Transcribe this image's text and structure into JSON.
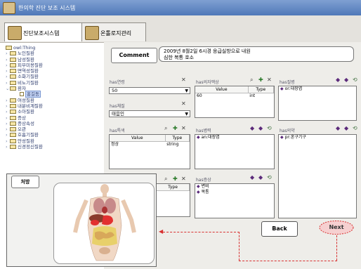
{
  "window": {
    "title": "한의학 진단 보조 시스템"
  },
  "tabs": [
    {
      "label": "진단보조시스템",
      "icon": "app-icon"
    },
    {
      "label": "온톨로지관리",
      "icon": "app-icon"
    }
  ],
  "tree": {
    "root": "owl:Thing",
    "items": [
      "노인질환",
      "남성질환",
      "피부미용질환",
      "면역성질환",
      "소화기질환",
      "비뇨기질환",
      "환자",
      "홍길동",
      "여성질환",
      "내분비계질환",
      "소아질환",
      "증상",
      "증상속성",
      "오관",
      "호흡기질환",
      "안성질환",
      "신경정신질환"
    ],
    "selected": "홍길동"
  },
  "comment": {
    "button": "Comment",
    "text_line1": "2009년 8월2일 6시경 응급실방으로 내원",
    "text_line2": "심한 복통 호소"
  },
  "properties": {
    "age": {
      "label": "has연령",
      "value": "50"
    },
    "constitution": {
      "label": "has체질",
      "value": "태음인"
    },
    "symptom_detail": {
      "label": "has의자맥상",
      "columns": [
        "Value",
        "Type"
      ],
      "rows": [
        [
          "60",
          "int"
        ]
      ]
    },
    "disease": {
      "label": "has질병",
      "items": [
        "or:대장염"
      ]
    },
    "traits": {
      "label": "has특색",
      "columns": [
        "Value",
        "Type"
      ],
      "rows": [
        [
          "정상",
          "string"
        ]
      ]
    },
    "lesion": {
      "label": "has병력",
      "items": [
        "an:대장염"
      ]
    },
    "organ": {
      "label": "has의약",
      "items": [
        "pr:혼구기구"
      ]
    },
    "mini_table": {
      "columns": [
        "Type"
      ]
    },
    "symptom": {
      "label": "has증상",
      "items": [
        "변비",
        "복통"
      ]
    }
  },
  "buttons": {
    "back": "Back",
    "next": "Next"
  },
  "popup": {
    "tab_label": "처방"
  },
  "colors": {
    "accent_blue": "#4f78b8",
    "annotation_red": "#d83030",
    "background": "#eeede9"
  }
}
